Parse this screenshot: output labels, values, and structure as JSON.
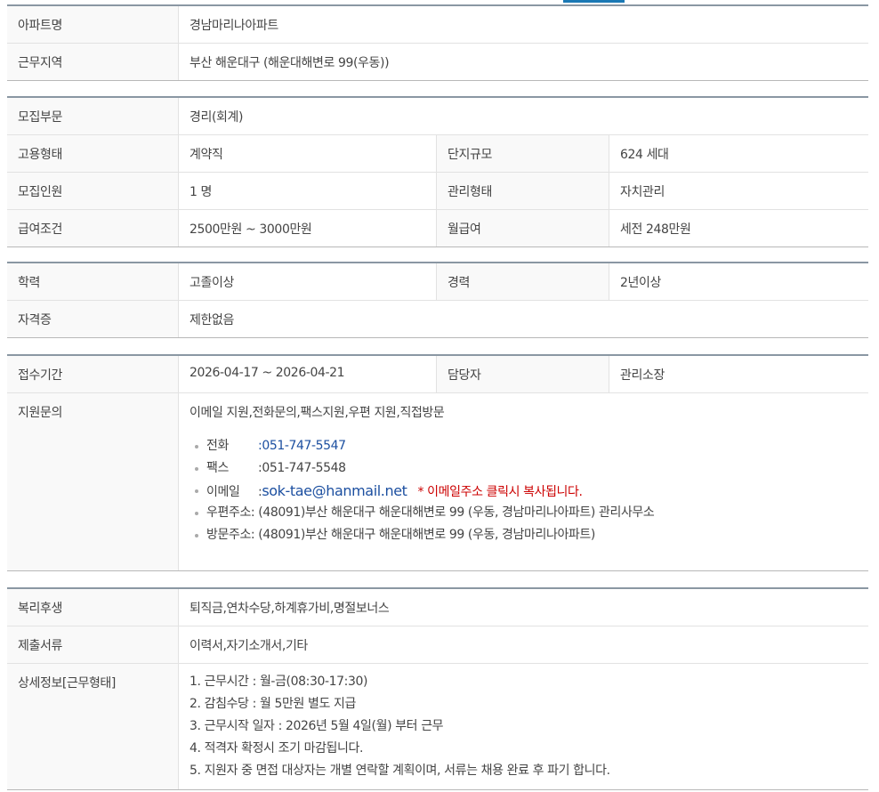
{
  "section1": {
    "apartment_label": "아파트명",
    "apartment_value": "경남마리나아파트",
    "location_label": "근무지역",
    "location_value": "부산  해운대구 (해운대해변로 99(우동))"
  },
  "section2": {
    "dept_label": "모집부문",
    "dept_value": "경리(회계)",
    "emp_type_label": "고용형태",
    "emp_type_value": "계약직",
    "complex_label": "단지규모",
    "complex_value": "624 세대",
    "headcount_label": "모집인원",
    "headcount_value": "1 명",
    "mgmt_label": "관리형태",
    "mgmt_value": "자치관리",
    "salary_label": "급여조건",
    "salary_value": "2500만원 ~ 3000만원",
    "monthly_label": "월급여",
    "monthly_value": "세전 248만원"
  },
  "section3": {
    "edu_label": "학력",
    "edu_value": "고졸이상",
    "career_label": "경력",
    "career_value": "2년이상",
    "cert_label": "자격증",
    "cert_value": "제한없음"
  },
  "section4": {
    "period_label": "접수기간",
    "period_value": "2026-04-17 ~ 2026-04-21",
    "manager_label": "담당자",
    "manager_value": "관리소장",
    "apply_label": "지원문의",
    "apply_methods": "이메일 지원,전화문의,팩스지원,우편 지원,직접방문",
    "phone_label": "전화",
    "phone_value": ":051-747-5547",
    "fax_label": "팩스",
    "fax_value": ":051-747-5548",
    "email_label": "이메일",
    "email_colon": ":",
    "email_value": "sok-tae@hanmail.net",
    "email_note": "* 이메일주소 클릭시 복사됩니다.",
    "postal_label": "우편주소",
    "postal_value": ": (48091)부산 해운대구 해운대해변로 99 (우동, 경남마리나아파트) 관리사무소",
    "visit_label": "방문주소",
    "visit_value": ": (48091)부산 해운대구 해운대해변로 99 (우동, 경남마리나아파트)"
  },
  "section5": {
    "welfare_label": "복리후생",
    "welfare_value": "퇴직금,연차수당,하계휴가비,명절보너스",
    "docs_label": "제출서류",
    "docs_value": "이력서,자기소개서,기타",
    "detail_label": "상세정보[근무형태]",
    "detail_lines": [
      "1. 근무시간 : 월-금(08:30-17:30)",
      "2. 감침수당 : 월 5만원 별도 지급",
      "3. 근무시작 일자 : 2026년 5월 4일(월) 부터 근무",
      "4. 적격자 확정시 조기 마감됩니다.",
      "5. 지원자 중 면접 대상자는 개별 연락할 계획이며, 서류는 채용 완료 후 파기 합니다."
    ]
  },
  "colors": {
    "accent": "#1a78b4",
    "link": "#1c4fa0",
    "notice": "#cc0000",
    "header_bg": "#f9f9f9"
  }
}
